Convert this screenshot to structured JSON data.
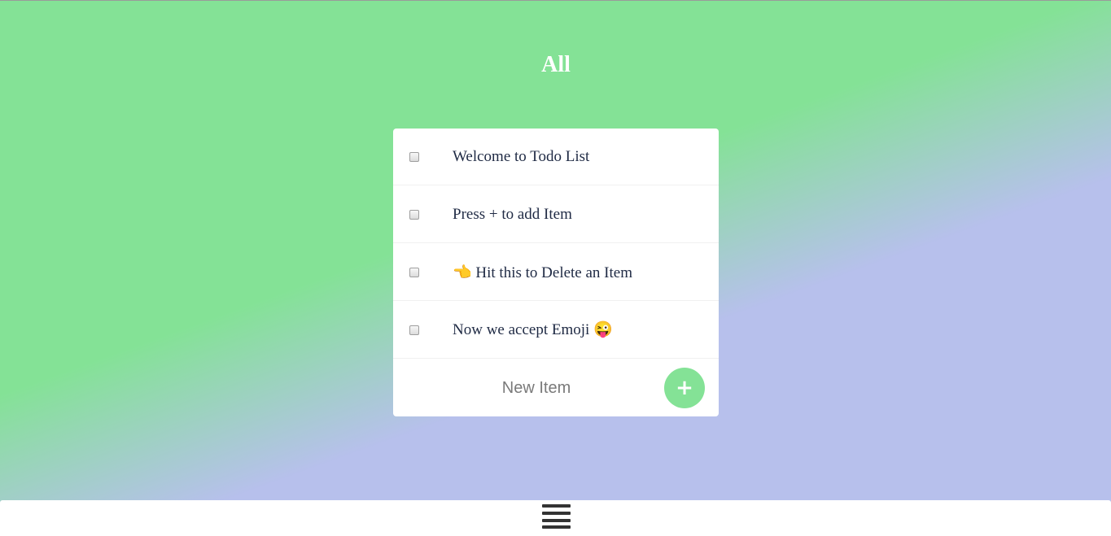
{
  "header": {
    "title": "All"
  },
  "todos": [
    {
      "text": "Welcome to Todo List",
      "checked": false
    },
    {
      "text": "Press + to add Item",
      "checked": false
    },
    {
      "text": "👈 Hit this to Delete an Item",
      "checked": false
    },
    {
      "text": "Now we accept Emoji 😜",
      "checked": false
    }
  ],
  "new_item": {
    "placeholder": "New Item",
    "add_label": "+"
  },
  "footer": {
    "menu_icon": "hamburger-menu-icon"
  },
  "colors": {
    "accent_green": "#84e296",
    "background_lavender": "#b7c0ec",
    "text_dark": "#1f2a44"
  }
}
